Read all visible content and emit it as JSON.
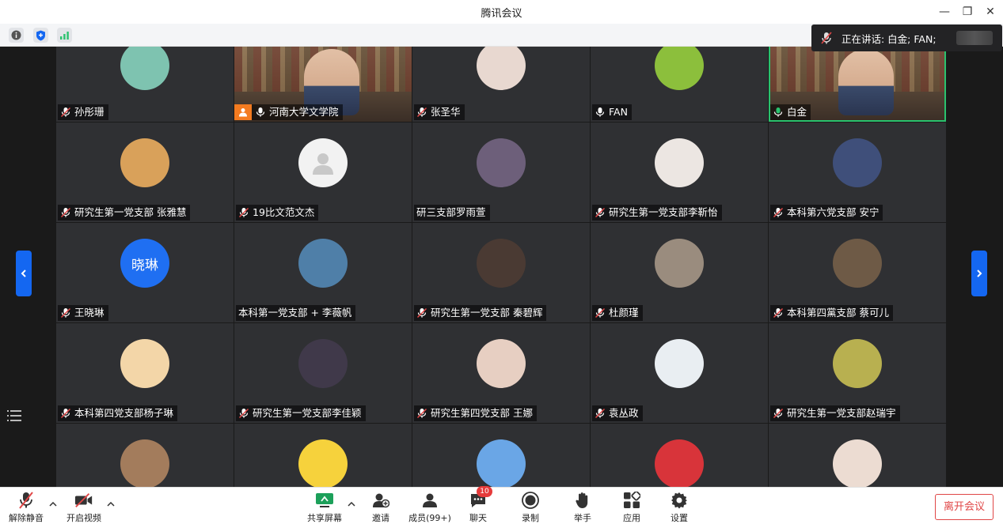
{
  "window": {
    "title": "腾讯会议",
    "minimize": "—",
    "restore": "❐",
    "close": "✕"
  },
  "speaking": {
    "label": "正在讲话: 白金; FAN;"
  },
  "tiles": [
    {
      "name": "孙彤珊",
      "mic": "muted",
      "avatar_color": "#7ec3b0",
      "avatar_text": ""
    },
    {
      "name": "河南大学文学院",
      "mic": "on",
      "video": true,
      "host": true
    },
    {
      "name": "张圣华",
      "mic": "muted",
      "avatar_color": "#e8d8d0",
      "avatar_text": ""
    },
    {
      "name": "FAN",
      "mic": "on",
      "avatar_color": "#8cbf3c",
      "avatar_text": ""
    },
    {
      "name": "白金",
      "mic": "active",
      "video": true,
      "active": true
    },
    {
      "name": "研究生第一党支部 张雅慧",
      "mic": "muted",
      "avatar_color": "#d9a15a",
      "avatar_text": ""
    },
    {
      "name": "19比文范文杰",
      "mic": "muted",
      "avatar_color": "#f2f2f2",
      "avatar_text": "",
      "placeholder": true
    },
    {
      "name": "研三支部罗雨萱",
      "mic": "none",
      "avatar_color": "#6d5f7a",
      "avatar_text": ""
    },
    {
      "name": "研究生第一党支部李靳怡",
      "mic": "muted",
      "avatar_color": "#ece6e2",
      "avatar_text": ""
    },
    {
      "name": "本科第六党支部 安宁",
      "mic": "muted",
      "avatar_color": "#3f4f7a",
      "avatar_text": ""
    },
    {
      "name": "王晓琳",
      "mic": "muted",
      "avatar_color": "#1f6ff2",
      "avatar_text": "晓琳"
    },
    {
      "name": "本科第一党支部 + 李薇帆",
      "mic": "none",
      "avatar_color": "#4f7fa8",
      "avatar_text": ""
    },
    {
      "name": "研究生第一党支部 秦碧辉",
      "mic": "muted",
      "avatar_color": "#4a3a33",
      "avatar_text": ""
    },
    {
      "name": "杜颜瑾",
      "mic": "muted",
      "avatar_color": "#9a8c7e",
      "avatar_text": ""
    },
    {
      "name": "本科第四黨支部 蔡可儿",
      "mic": "muted",
      "avatar_color": "#6e5a46",
      "avatar_text": ""
    },
    {
      "name": "本科第四党支部杨子琳",
      "mic": "muted",
      "avatar_color": "#f3d6a8",
      "avatar_text": ""
    },
    {
      "name": "研究生第一党支部李佳颖",
      "mic": "muted",
      "avatar_color": "#40394a",
      "avatar_text": ""
    },
    {
      "name": "研究生第四党支部 王娜",
      "mic": "muted",
      "avatar_color": "#e7cfc2",
      "avatar_text": ""
    },
    {
      "name": "袁丛政",
      "mic": "muted",
      "avatar_color": "#e9eef2",
      "avatar_text": ""
    },
    {
      "name": "研究生第一党支部赵瑞宇",
      "mic": "muted",
      "avatar_color": "#b8b050",
      "avatar_text": ""
    },
    {
      "name": "",
      "mic": "none",
      "avatar_color": "#a37c5c",
      "avatar_text": ""
    },
    {
      "name": "",
      "mic": "none",
      "avatar_color": "#f6d23c",
      "avatar_text": ""
    },
    {
      "name": "",
      "mic": "none",
      "avatar_color": "#6aa6e6",
      "avatar_text": ""
    },
    {
      "name": "",
      "mic": "none",
      "avatar_color": "#d8343a",
      "avatar_text": ""
    },
    {
      "name": "",
      "mic": "none",
      "avatar_color": "#ecdcd2",
      "avatar_text": ""
    }
  ],
  "toolbar": {
    "unmute": "解除静音",
    "start_video": "开启视频",
    "share_screen": "共享屏幕",
    "invite": "邀请",
    "members": "成员(99+)",
    "chat": "聊天",
    "chat_badge": "10",
    "record": "录制",
    "raise_hand": "举手",
    "apps": "应用",
    "settings": "设置",
    "leave": "离开会议"
  },
  "colors": {
    "accent": "#1467f1",
    "danger": "#e04646",
    "active_speaker": "#2ac26e"
  }
}
